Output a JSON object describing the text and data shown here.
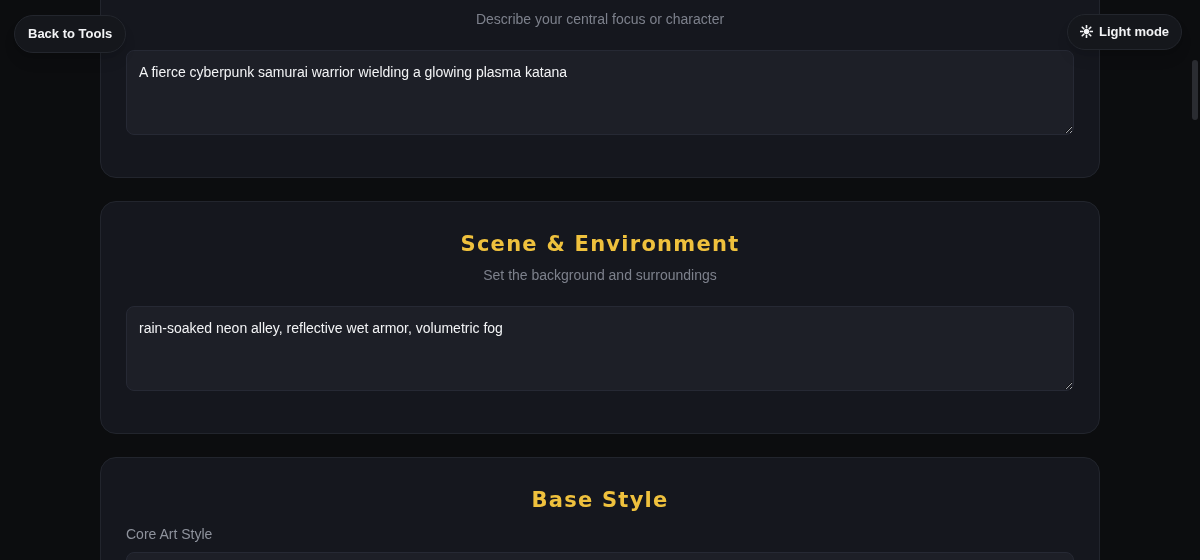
{
  "nav": {
    "back_button": "Back to Tools",
    "theme_button": "Light mode"
  },
  "sections": [
    {
      "kind": "prompt",
      "subtitle": "Describe your central focus or character",
      "value": "A fierce cyberpunk samurai warrior wielding a glowing plasma katana"
    },
    {
      "kind": "prompt",
      "title": "Scene & Environment",
      "subtitle": "Set the background and surroundings",
      "value": "rain-soaked neon alley, reflective wet armor, volumetric fog"
    },
    {
      "kind": "style",
      "title": "Base Style",
      "field_label": "Core Art Style"
    }
  ]
}
